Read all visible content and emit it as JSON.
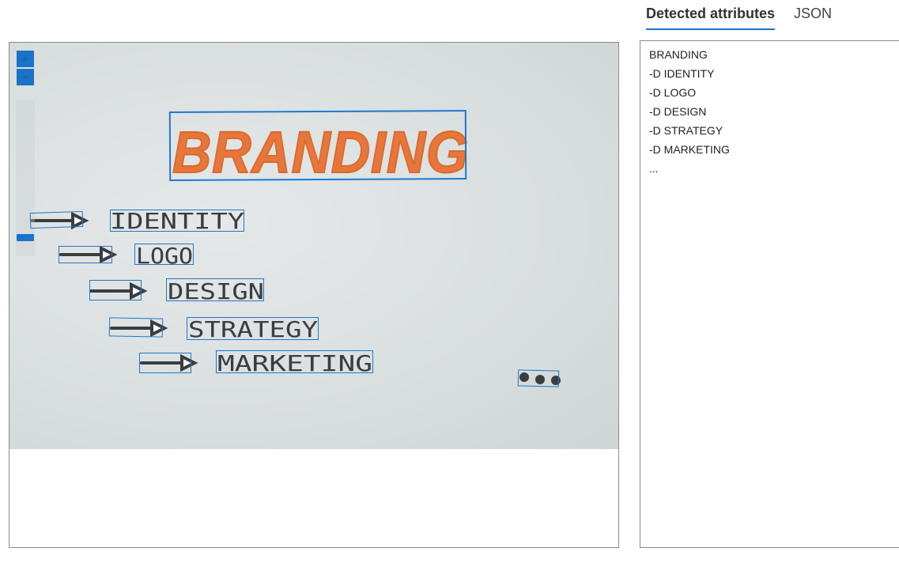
{
  "tabs": {
    "detected_attributes": "Detected attributes",
    "json": "JSON"
  },
  "viewer": {
    "zoom_in_label": "+",
    "zoom_out_label": "−",
    "image_text": {
      "title": "BRANDING",
      "items": [
        "IDENTITY",
        "LOGO",
        "DESIGN",
        "STRATEGY",
        "MARKETING"
      ]
    }
  },
  "attributes": [
    "BRANDING",
    "-D IDENTITY",
    "-D LOGO",
    "-D DESIGN",
    "-D STRATEGY",
    "-D MARKETING",
    "..."
  ],
  "colors": {
    "accent": "#1a73c9",
    "bbox": "#1d78cf",
    "title_orange": "#e8763a",
    "marker_ink": "#3a3d40"
  }
}
